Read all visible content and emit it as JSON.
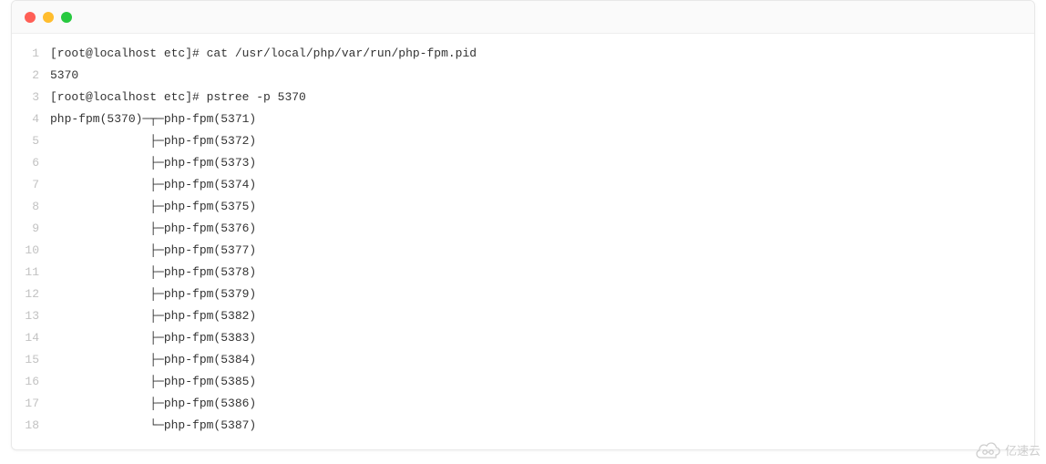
{
  "window": {
    "dots": [
      "close",
      "minimize",
      "zoom"
    ]
  },
  "code": {
    "lines": [
      "[root@localhost etc]# cat /usr/local/php/var/run/php-fpm.pid",
      "5370",
      "[root@localhost etc]# pstree -p 5370",
      "php-fpm(5370)─┬─php-fpm(5371)",
      "              ├─php-fpm(5372)",
      "              ├─php-fpm(5373)",
      "              ├─php-fpm(5374)",
      "              ├─php-fpm(5375)",
      "              ├─php-fpm(5376)",
      "              ├─php-fpm(5377)",
      "              ├─php-fpm(5378)",
      "              ├─php-fpm(5379)",
      "              ├─php-fpm(5382)",
      "              ├─php-fpm(5383)",
      "              ├─php-fpm(5384)",
      "              ├─php-fpm(5385)",
      "              ├─php-fpm(5386)",
      "              └─php-fpm(5387)"
    ]
  },
  "watermark": {
    "text": "亿速云"
  }
}
